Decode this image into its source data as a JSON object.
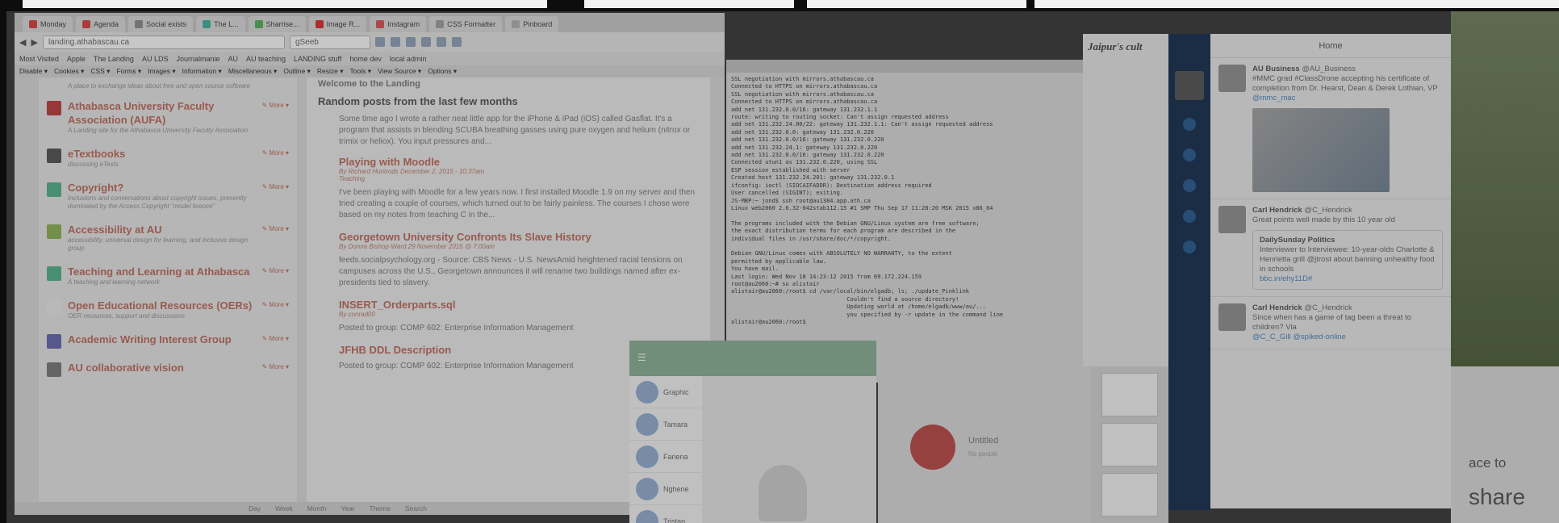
{
  "browser": {
    "tabs": [
      {
        "label": "Monday",
        "color": "#c44"
      },
      {
        "label": "Agenda",
        "color": "#c44"
      },
      {
        "label": "Social exists",
        "color": "#888"
      },
      {
        "label": "The L...",
        "color": "#4a9"
      },
      {
        "label": "Sharrise...",
        "color": "#5a5"
      },
      {
        "label": "Image R...",
        "color": "#c33"
      },
      {
        "label": "Instagram",
        "color": "#c55"
      },
      {
        "label": "CSS Formatter",
        "color": "#999"
      },
      {
        "label": "Pinboard",
        "color": "#aaa"
      }
    ],
    "url": "landing.athabascau.ca",
    "search_placeholder": "gSeeb",
    "bookmarks": [
      "Most Visited",
      "Apple",
      "The Landing",
      "AU LDS",
      "Journalmanie",
      "AU",
      "AU teaching",
      "LANDING stuff",
      "home dev",
      "local admin"
    ],
    "webdev": [
      "Disable",
      "Cookies",
      "CSS",
      "Forms",
      "Images",
      "Information",
      "Miscellaneous",
      "Outline",
      "Resize",
      "Tools",
      "View Source",
      "Options"
    ],
    "groups": [
      {
        "desc_top": "A place to exchange ideas about free and open source software"
      },
      {
        "title": "Athabasca University Faculty Association (AUFA)",
        "desc": "A Landing site for the Athabasca University Faculty Association",
        "icon": "#b34040"
      },
      {
        "title": "eTextbooks",
        "desc": "discussing eTexts",
        "icon": "#555"
      },
      {
        "title": "Copyright?",
        "desc": "Inclusions and conversations about copyright issues, presently dominated by the Access Copyright \"model licence\"",
        "icon": "#5a8"
      },
      {
        "title": "Accessibility at AU",
        "desc": "accessibility, universal design for learning, and inclusive design group",
        "icon": "#8a5"
      },
      {
        "title": "Teaching and Learning at Athabasca",
        "desc": "A teaching and learning network",
        "icon": "#5a8"
      },
      {
        "title": "Open Educational Resources (OERs)",
        "desc": "OER resources, support and discussions",
        "icon": "#ddd"
      },
      {
        "title": "Academic Writing Interest Group",
        "desc": "",
        "icon": "#66a"
      },
      {
        "title": "AU collaborative vision",
        "desc": "",
        "icon": "#777"
      }
    ],
    "group_actions": "More",
    "section_top": "Welcome to the Landing",
    "section_title": "Random posts from the last few months",
    "intro": "Some time ago I wrote a rather neat little app for the iPhone & iPad (iOS) called Gasflat. It's a program that assists in blending SCUBA breathing gasses using pure oxygen and helium (nitrox or trimix or heliox). You input pressures and...",
    "posts": [
      {
        "title": "Playing with Moodle",
        "meta": "By Richard Huntrods December 2, 2015 - 10:37am",
        "tag": "Teaching",
        "text": "I've been playing with Moodle for a few years now. I first installed Moodle 1.9 on my server and then tried creating a couple of courses, which turned out to be fairly painless. The courses I chose were based on my notes from teaching C in the..."
      },
      {
        "title": "Georgetown University Confronts Its Slave History",
        "meta": "By Donna Bishop-Ward 29 November 2015 @ 7:00am",
        "tag": "",
        "text": "feeds.socialpsychology.org - Source: CBS News - U.S. NewsAmid heightened racial tensions on campuses across the U.S., Georgetown announces it will rename two buildings named after ex-presidents tied to slavery."
      },
      {
        "title": "INSERT_Orderparts.sql",
        "meta": "By conrad00",
        "tag": "",
        "text": "Posted to group: COMP 602: Enterprise Information Management"
      },
      {
        "title": "JFHB DDL Description",
        "meta": "",
        "tag": "",
        "text": "Posted to group: COMP 602: Enterprise Information Management"
      }
    ],
    "status_items": [
      "Day",
      "Week",
      "Month",
      "Year",
      "Theme",
      "Search"
    ]
  },
  "terminal": {
    "lines": [
      "SSL negotiation with mirrors.athabascau.ca",
      "Connected to HTTPS on mirrors.athabascau.ca",
      "SSL negotiation with mirrors.athabascau.ca",
      "Connected to HTTPS on mirrors.athabascau.ca",
      "add net 131.232.0.0/16: gateway 131.232.1.1",
      "route: writing to routing socket: Can't assign requested address",
      "add net 131.232.24.00/22: gateway 131.232.1.1: Can't assign requested address",
      "add net 131.232.0.0: gateway 131.232.0.220",
      "add net 131.232.0.0/16: gateway 131.232.0.220",
      "add net 131.232.24.1: gateway 131.232.0.220",
      "add net 131.232.0.0/16: gateway 131.232.0.220",
      "Connected utun1 as 131.232.0.220, using SSL",
      "ESP session established with server",
      "Created host 131.232.24.201: gateway 131.232.0.1",
      "ifconfig: ioctl (SIOCAIFADDR): Destination address required",
      "User cancelled (SIGINT); exiting.",
      "JS-MBP:~ jond$ ssh root@au1384.app.ath.ca",
      "Linux web2060 2.6.32-042stab112.15 #1 SMP Thu Sep 17 11:28:20 MSK 2015 x86_64",
      "",
      "The programs included with the Debian GNU/Linux system are free software;",
      "the exact distribution terms for each program are described in the",
      "individual files in /usr/share/doc/*/copyright.",
      "",
      "Debian GNU/Linux comes with ABSOLUTELY NO WARRANTY, to the extent",
      "permitted by applicable law.",
      "You have mail.",
      "Last login: Wed Nov 18 14:23:12 2015 from 69.172.224.159",
      "root@au2060:~# su alistair",
      "alistair@au2060:/root$ cd /var/local/bin/elgadb; ls; ./update_Pinklink",
      "                                  Couldn't find a source directory!",
      "                                  Updating world at /home/elgadb/www/au/...",
      "                                  you specified by -r update in the command line",
      "alistair@au2060:/root$"
    ]
  },
  "article": {
    "title": "Jaipur's cult"
  },
  "twitter": {
    "header": "Home",
    "tweets": [
      {
        "name": "AU Business",
        "handle": "@AU_Business",
        "text": "#MMC grad #ClassDrone accepting his certificate of completion from Dr. Hearst, Dean & Derek Lothian, VP",
        "link": "@mmc_mac"
      },
      {
        "name": "Carl Hendrick",
        "handle": "@C_Hendrick",
        "text": "Great points well made by this 10 year old",
        "quote_name": "DailySunday Politics",
        "quote_text": "Interviewer to Interviewee: 10-year-olds Charlotte & Henrietta grill @jtrost about banning unhealthy food in schools",
        "quote_link": "bbc.in/ehy11D#"
      },
      {
        "name": "Carl Hendrick",
        "handle": "@C_Hendrick",
        "text": "Since when has a game of tag been a threat to children? Via",
        "link": "@C_C_Gill @spiked-online"
      }
    ]
  },
  "chat": {
    "rows": [
      "Graphic",
      "Tamara",
      "Fariena",
      "Nghene",
      "Tristan"
    ]
  },
  "editor": {
    "title": "Untitled",
    "sub": "No people"
  },
  "share": {
    "line1": "ace to",
    "line2": "share"
  }
}
